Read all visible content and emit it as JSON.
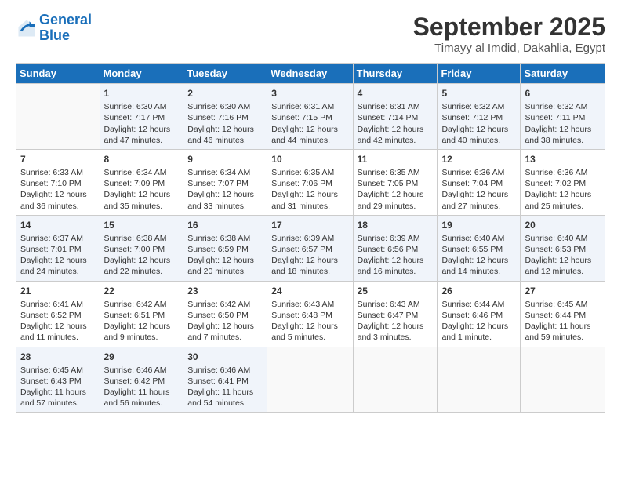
{
  "logo": {
    "line1": "General",
    "line2": "Blue"
  },
  "title": "September 2025",
  "location": "Timayy al Imdid, Dakahlia, Egypt",
  "headers": [
    "Sunday",
    "Monday",
    "Tuesday",
    "Wednesday",
    "Thursday",
    "Friday",
    "Saturday"
  ],
  "weeks": [
    [
      {
        "day": "",
        "info": ""
      },
      {
        "day": "1",
        "info": "Sunrise: 6:30 AM\nSunset: 7:17 PM\nDaylight: 12 hours\nand 47 minutes."
      },
      {
        "day": "2",
        "info": "Sunrise: 6:30 AM\nSunset: 7:16 PM\nDaylight: 12 hours\nand 46 minutes."
      },
      {
        "day": "3",
        "info": "Sunrise: 6:31 AM\nSunset: 7:15 PM\nDaylight: 12 hours\nand 44 minutes."
      },
      {
        "day": "4",
        "info": "Sunrise: 6:31 AM\nSunset: 7:14 PM\nDaylight: 12 hours\nand 42 minutes."
      },
      {
        "day": "5",
        "info": "Sunrise: 6:32 AM\nSunset: 7:12 PM\nDaylight: 12 hours\nand 40 minutes."
      },
      {
        "day": "6",
        "info": "Sunrise: 6:32 AM\nSunset: 7:11 PM\nDaylight: 12 hours\nand 38 minutes."
      }
    ],
    [
      {
        "day": "7",
        "info": "Sunrise: 6:33 AM\nSunset: 7:10 PM\nDaylight: 12 hours\nand 36 minutes."
      },
      {
        "day": "8",
        "info": "Sunrise: 6:34 AM\nSunset: 7:09 PM\nDaylight: 12 hours\nand 35 minutes."
      },
      {
        "day": "9",
        "info": "Sunrise: 6:34 AM\nSunset: 7:07 PM\nDaylight: 12 hours\nand 33 minutes."
      },
      {
        "day": "10",
        "info": "Sunrise: 6:35 AM\nSunset: 7:06 PM\nDaylight: 12 hours\nand 31 minutes."
      },
      {
        "day": "11",
        "info": "Sunrise: 6:35 AM\nSunset: 7:05 PM\nDaylight: 12 hours\nand 29 minutes."
      },
      {
        "day": "12",
        "info": "Sunrise: 6:36 AM\nSunset: 7:04 PM\nDaylight: 12 hours\nand 27 minutes."
      },
      {
        "day": "13",
        "info": "Sunrise: 6:36 AM\nSunset: 7:02 PM\nDaylight: 12 hours\nand 25 minutes."
      }
    ],
    [
      {
        "day": "14",
        "info": "Sunrise: 6:37 AM\nSunset: 7:01 PM\nDaylight: 12 hours\nand 24 minutes."
      },
      {
        "day": "15",
        "info": "Sunrise: 6:38 AM\nSunset: 7:00 PM\nDaylight: 12 hours\nand 22 minutes."
      },
      {
        "day": "16",
        "info": "Sunrise: 6:38 AM\nSunset: 6:59 PM\nDaylight: 12 hours\nand 20 minutes."
      },
      {
        "day": "17",
        "info": "Sunrise: 6:39 AM\nSunset: 6:57 PM\nDaylight: 12 hours\nand 18 minutes."
      },
      {
        "day": "18",
        "info": "Sunrise: 6:39 AM\nSunset: 6:56 PM\nDaylight: 12 hours\nand 16 minutes."
      },
      {
        "day": "19",
        "info": "Sunrise: 6:40 AM\nSunset: 6:55 PM\nDaylight: 12 hours\nand 14 minutes."
      },
      {
        "day": "20",
        "info": "Sunrise: 6:40 AM\nSunset: 6:53 PM\nDaylight: 12 hours\nand 12 minutes."
      }
    ],
    [
      {
        "day": "21",
        "info": "Sunrise: 6:41 AM\nSunset: 6:52 PM\nDaylight: 12 hours\nand 11 minutes."
      },
      {
        "day": "22",
        "info": "Sunrise: 6:42 AM\nSunset: 6:51 PM\nDaylight: 12 hours\nand 9 minutes."
      },
      {
        "day": "23",
        "info": "Sunrise: 6:42 AM\nSunset: 6:50 PM\nDaylight: 12 hours\nand 7 minutes."
      },
      {
        "day": "24",
        "info": "Sunrise: 6:43 AM\nSunset: 6:48 PM\nDaylight: 12 hours\nand 5 minutes."
      },
      {
        "day": "25",
        "info": "Sunrise: 6:43 AM\nSunset: 6:47 PM\nDaylight: 12 hours\nand 3 minutes."
      },
      {
        "day": "26",
        "info": "Sunrise: 6:44 AM\nSunset: 6:46 PM\nDaylight: 12 hours\nand 1 minute."
      },
      {
        "day": "27",
        "info": "Sunrise: 6:45 AM\nSunset: 6:44 PM\nDaylight: 11 hours\nand 59 minutes."
      }
    ],
    [
      {
        "day": "28",
        "info": "Sunrise: 6:45 AM\nSunset: 6:43 PM\nDaylight: 11 hours\nand 57 minutes."
      },
      {
        "day": "29",
        "info": "Sunrise: 6:46 AM\nSunset: 6:42 PM\nDaylight: 11 hours\nand 56 minutes."
      },
      {
        "day": "30",
        "info": "Sunrise: 6:46 AM\nSunset: 6:41 PM\nDaylight: 11 hours\nand 54 minutes."
      },
      {
        "day": "",
        "info": ""
      },
      {
        "day": "",
        "info": ""
      },
      {
        "day": "",
        "info": ""
      },
      {
        "day": "",
        "info": ""
      }
    ]
  ]
}
